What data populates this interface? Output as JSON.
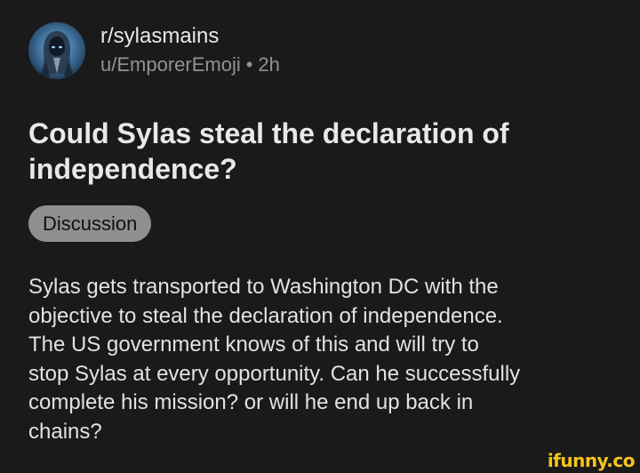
{
  "post": {
    "subreddit": "r/sylasmains",
    "author": "u/EmporerEmoji",
    "separator": "•",
    "age": "2h",
    "title": "Could Sylas steal the declaration of independence?",
    "flair": "Discussion",
    "body": "Sylas gets transported to Washington DC with the\nobjective to steal the declaration of  independence.\nThe US government knows of this and will try to\nstop Sylas at every opportunity. Can he successfully\ncomplete his mission? or will he end up back in\nchains?"
  },
  "watermark": {
    "text": "ifunny.co",
    "color": "#f5c518"
  },
  "icons": {
    "avatar": "hooded-figure-avatar"
  }
}
